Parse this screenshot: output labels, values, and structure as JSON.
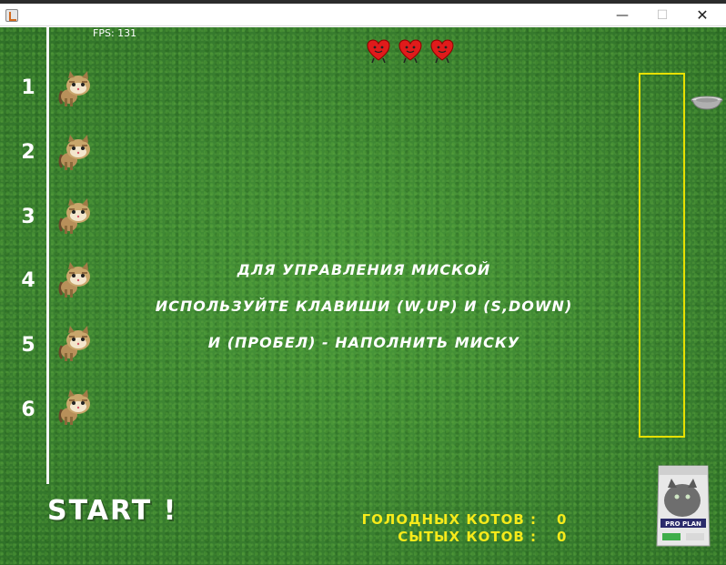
{
  "window": {
    "title": "",
    "controls": {
      "minimize": "—",
      "maximize": "☐",
      "close": "✕"
    }
  },
  "hud": {
    "fps_text": "FPS: 131",
    "lives": 3
  },
  "lanes": [
    {
      "number": "1"
    },
    {
      "number": "2"
    },
    {
      "number": "3"
    },
    {
      "number": "4"
    },
    {
      "number": "5"
    },
    {
      "number": "6"
    }
  ],
  "instructions": {
    "line1": "ДЛЯ УПРАВЛЕНИЯ МИСКОЙ",
    "line2": "ИСПОЛЬЗУЙТЕ КЛАВИШИ (W,UP) И (S,DOWN)",
    "line3": "И  (ПРОБЕЛ) - НАПОЛНИТЬ МИСКУ"
  },
  "start_label": "START !",
  "stats": {
    "hungry_label": "ГОЛОДНЫХ КОТОВ :",
    "hungry_value": "0",
    "fed_label": "СЫТЫХ КОТОВ :",
    "fed_value": "0"
  },
  "food_bag": {
    "brand_text": "PRO PLAN"
  },
  "bowl_fill_level": 0,
  "colors": {
    "grass": "#3f8a32",
    "meter_border": "#e8e000",
    "stats_text": "#f6ea1a",
    "heart": "#e01b1b"
  },
  "icons": [
    "heart-icon",
    "cat-icon",
    "bowl-icon",
    "food-bag-icon"
  ]
}
